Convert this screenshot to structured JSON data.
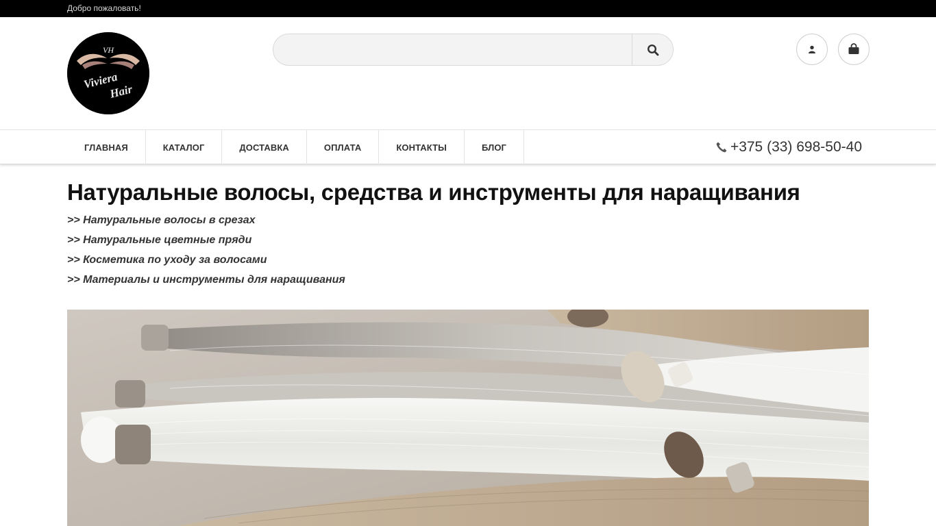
{
  "topbar": {
    "welcome": "Добро пожаловать!"
  },
  "header": {
    "logo": {
      "alt": "Viviera Hair",
      "monogram": "VH",
      "line1": "Viviera",
      "line2": "Hair"
    },
    "search": {
      "placeholder": "",
      "value": "",
      "button_icon": "search-icon"
    },
    "account_icon": "user-icon",
    "cart_icon": "shopping-bag-icon"
  },
  "nav": {
    "items": [
      {
        "label": "ГЛАВНАЯ"
      },
      {
        "label": "КАТАЛОГ"
      },
      {
        "label": "ДОСТАВКА"
      },
      {
        "label": "ОПЛАТА"
      },
      {
        "label": "КОНТАКТЫ"
      },
      {
        "label": "БЛОГ"
      }
    ],
    "phone": "+375 (33) 698-50-40",
    "phone_icon": "phone-icon"
  },
  "main": {
    "title": "Натуральные волосы, средства и инструменты для наращивания",
    "links": [
      {
        "label": ">> Натуральные волосы в срезах"
      },
      {
        "label": ">> Натуральные цветные пряди"
      },
      {
        "label": ">> Косметика по уходу за волосами"
      },
      {
        "label": ">> Материалы и инструменты для наращивания"
      }
    ]
  },
  "colors": {
    "topbar": "#000000",
    "text_dark": "#111111",
    "border": "#e3e3e3",
    "search_bg": "#f3f3f3"
  }
}
